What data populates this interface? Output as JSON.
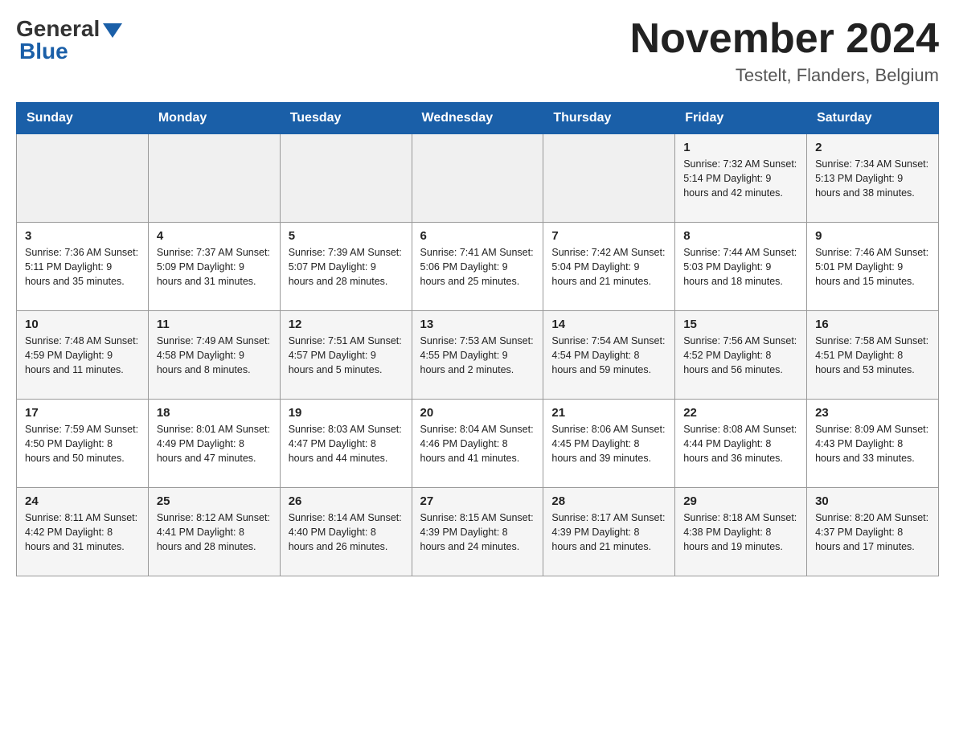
{
  "header": {
    "logo_general": "General",
    "logo_blue": "Blue",
    "month_title": "November 2024",
    "location": "Testelt, Flanders, Belgium"
  },
  "days_of_week": [
    "Sunday",
    "Monday",
    "Tuesday",
    "Wednesday",
    "Thursday",
    "Friday",
    "Saturday"
  ],
  "weeks": [
    {
      "days": [
        {
          "number": "",
          "info": ""
        },
        {
          "number": "",
          "info": ""
        },
        {
          "number": "",
          "info": ""
        },
        {
          "number": "",
          "info": ""
        },
        {
          "number": "",
          "info": ""
        },
        {
          "number": "1",
          "info": "Sunrise: 7:32 AM\nSunset: 5:14 PM\nDaylight: 9 hours\nand 42 minutes."
        },
        {
          "number": "2",
          "info": "Sunrise: 7:34 AM\nSunset: 5:13 PM\nDaylight: 9 hours\nand 38 minutes."
        }
      ]
    },
    {
      "days": [
        {
          "number": "3",
          "info": "Sunrise: 7:36 AM\nSunset: 5:11 PM\nDaylight: 9 hours\nand 35 minutes."
        },
        {
          "number": "4",
          "info": "Sunrise: 7:37 AM\nSunset: 5:09 PM\nDaylight: 9 hours\nand 31 minutes."
        },
        {
          "number": "5",
          "info": "Sunrise: 7:39 AM\nSunset: 5:07 PM\nDaylight: 9 hours\nand 28 minutes."
        },
        {
          "number": "6",
          "info": "Sunrise: 7:41 AM\nSunset: 5:06 PM\nDaylight: 9 hours\nand 25 minutes."
        },
        {
          "number": "7",
          "info": "Sunrise: 7:42 AM\nSunset: 5:04 PM\nDaylight: 9 hours\nand 21 minutes."
        },
        {
          "number": "8",
          "info": "Sunrise: 7:44 AM\nSunset: 5:03 PM\nDaylight: 9 hours\nand 18 minutes."
        },
        {
          "number": "9",
          "info": "Sunrise: 7:46 AM\nSunset: 5:01 PM\nDaylight: 9 hours\nand 15 minutes."
        }
      ]
    },
    {
      "days": [
        {
          "number": "10",
          "info": "Sunrise: 7:48 AM\nSunset: 4:59 PM\nDaylight: 9 hours\nand 11 minutes."
        },
        {
          "number": "11",
          "info": "Sunrise: 7:49 AM\nSunset: 4:58 PM\nDaylight: 9 hours\nand 8 minutes."
        },
        {
          "number": "12",
          "info": "Sunrise: 7:51 AM\nSunset: 4:57 PM\nDaylight: 9 hours\nand 5 minutes."
        },
        {
          "number": "13",
          "info": "Sunrise: 7:53 AM\nSunset: 4:55 PM\nDaylight: 9 hours\nand 2 minutes."
        },
        {
          "number": "14",
          "info": "Sunrise: 7:54 AM\nSunset: 4:54 PM\nDaylight: 8 hours\nand 59 minutes."
        },
        {
          "number": "15",
          "info": "Sunrise: 7:56 AM\nSunset: 4:52 PM\nDaylight: 8 hours\nand 56 minutes."
        },
        {
          "number": "16",
          "info": "Sunrise: 7:58 AM\nSunset: 4:51 PM\nDaylight: 8 hours\nand 53 minutes."
        }
      ]
    },
    {
      "days": [
        {
          "number": "17",
          "info": "Sunrise: 7:59 AM\nSunset: 4:50 PM\nDaylight: 8 hours\nand 50 minutes."
        },
        {
          "number": "18",
          "info": "Sunrise: 8:01 AM\nSunset: 4:49 PM\nDaylight: 8 hours\nand 47 minutes."
        },
        {
          "number": "19",
          "info": "Sunrise: 8:03 AM\nSunset: 4:47 PM\nDaylight: 8 hours\nand 44 minutes."
        },
        {
          "number": "20",
          "info": "Sunrise: 8:04 AM\nSunset: 4:46 PM\nDaylight: 8 hours\nand 41 minutes."
        },
        {
          "number": "21",
          "info": "Sunrise: 8:06 AM\nSunset: 4:45 PM\nDaylight: 8 hours\nand 39 minutes."
        },
        {
          "number": "22",
          "info": "Sunrise: 8:08 AM\nSunset: 4:44 PM\nDaylight: 8 hours\nand 36 minutes."
        },
        {
          "number": "23",
          "info": "Sunrise: 8:09 AM\nSunset: 4:43 PM\nDaylight: 8 hours\nand 33 minutes."
        }
      ]
    },
    {
      "days": [
        {
          "number": "24",
          "info": "Sunrise: 8:11 AM\nSunset: 4:42 PM\nDaylight: 8 hours\nand 31 minutes."
        },
        {
          "number": "25",
          "info": "Sunrise: 8:12 AM\nSunset: 4:41 PM\nDaylight: 8 hours\nand 28 minutes."
        },
        {
          "number": "26",
          "info": "Sunrise: 8:14 AM\nSunset: 4:40 PM\nDaylight: 8 hours\nand 26 minutes."
        },
        {
          "number": "27",
          "info": "Sunrise: 8:15 AM\nSunset: 4:39 PM\nDaylight: 8 hours\nand 24 minutes."
        },
        {
          "number": "28",
          "info": "Sunrise: 8:17 AM\nSunset: 4:39 PM\nDaylight: 8 hours\nand 21 minutes."
        },
        {
          "number": "29",
          "info": "Sunrise: 8:18 AM\nSunset: 4:38 PM\nDaylight: 8 hours\nand 19 minutes."
        },
        {
          "number": "30",
          "info": "Sunrise: 8:20 AM\nSunset: 4:37 PM\nDaylight: 8 hours\nand 17 minutes."
        }
      ]
    }
  ]
}
